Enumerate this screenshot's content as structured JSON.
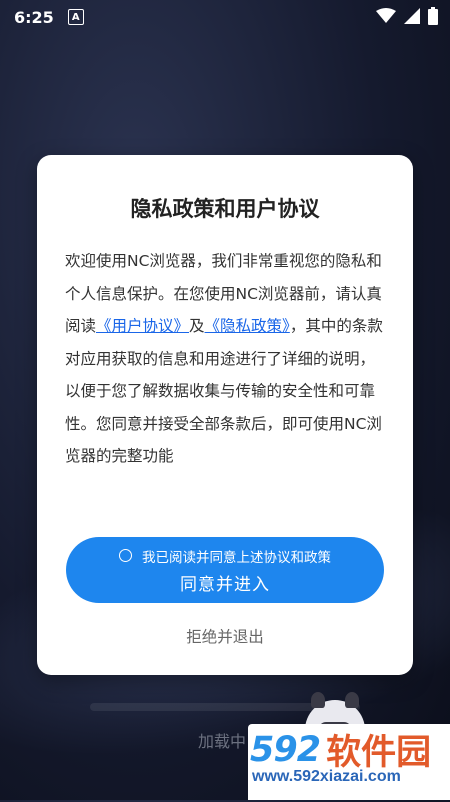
{
  "status_bar": {
    "time": "6:25",
    "badge": "A",
    "icons": [
      "wifi-icon",
      "signal-icon",
      "battery-icon"
    ]
  },
  "dialog": {
    "title": "隐私政策和用户协议",
    "body": {
      "part1": "欢迎使用NC浏览器，我们非常重视您的隐私和个人信息保护。在您使用NC浏览器前，请认真阅读",
      "link1": "《用户协议》",
      "and": "及",
      "link2": "《隐私政策》",
      "part2": "，其中的条款对应用获取的信息和用途进行了详细的说明，以便于您了解数据收集与传输的安全性和可靠性。您同意并接受全部条款后，即可使用NC浏览器的完整功能"
    },
    "agree_checkbox_label": "我已阅读并同意上述协议和政策",
    "agree_button_label": "同意并进入",
    "reject_label": "拒绝并退出"
  },
  "loading": {
    "text": "加载中"
  },
  "watermark": {
    "number": "592",
    "chinese": "软件园",
    "url": "www.592xiazai.com"
  },
  "colors": {
    "primary_button": "#1e86ee",
    "link": "#1a66e8",
    "background": "#151a2e"
  }
}
